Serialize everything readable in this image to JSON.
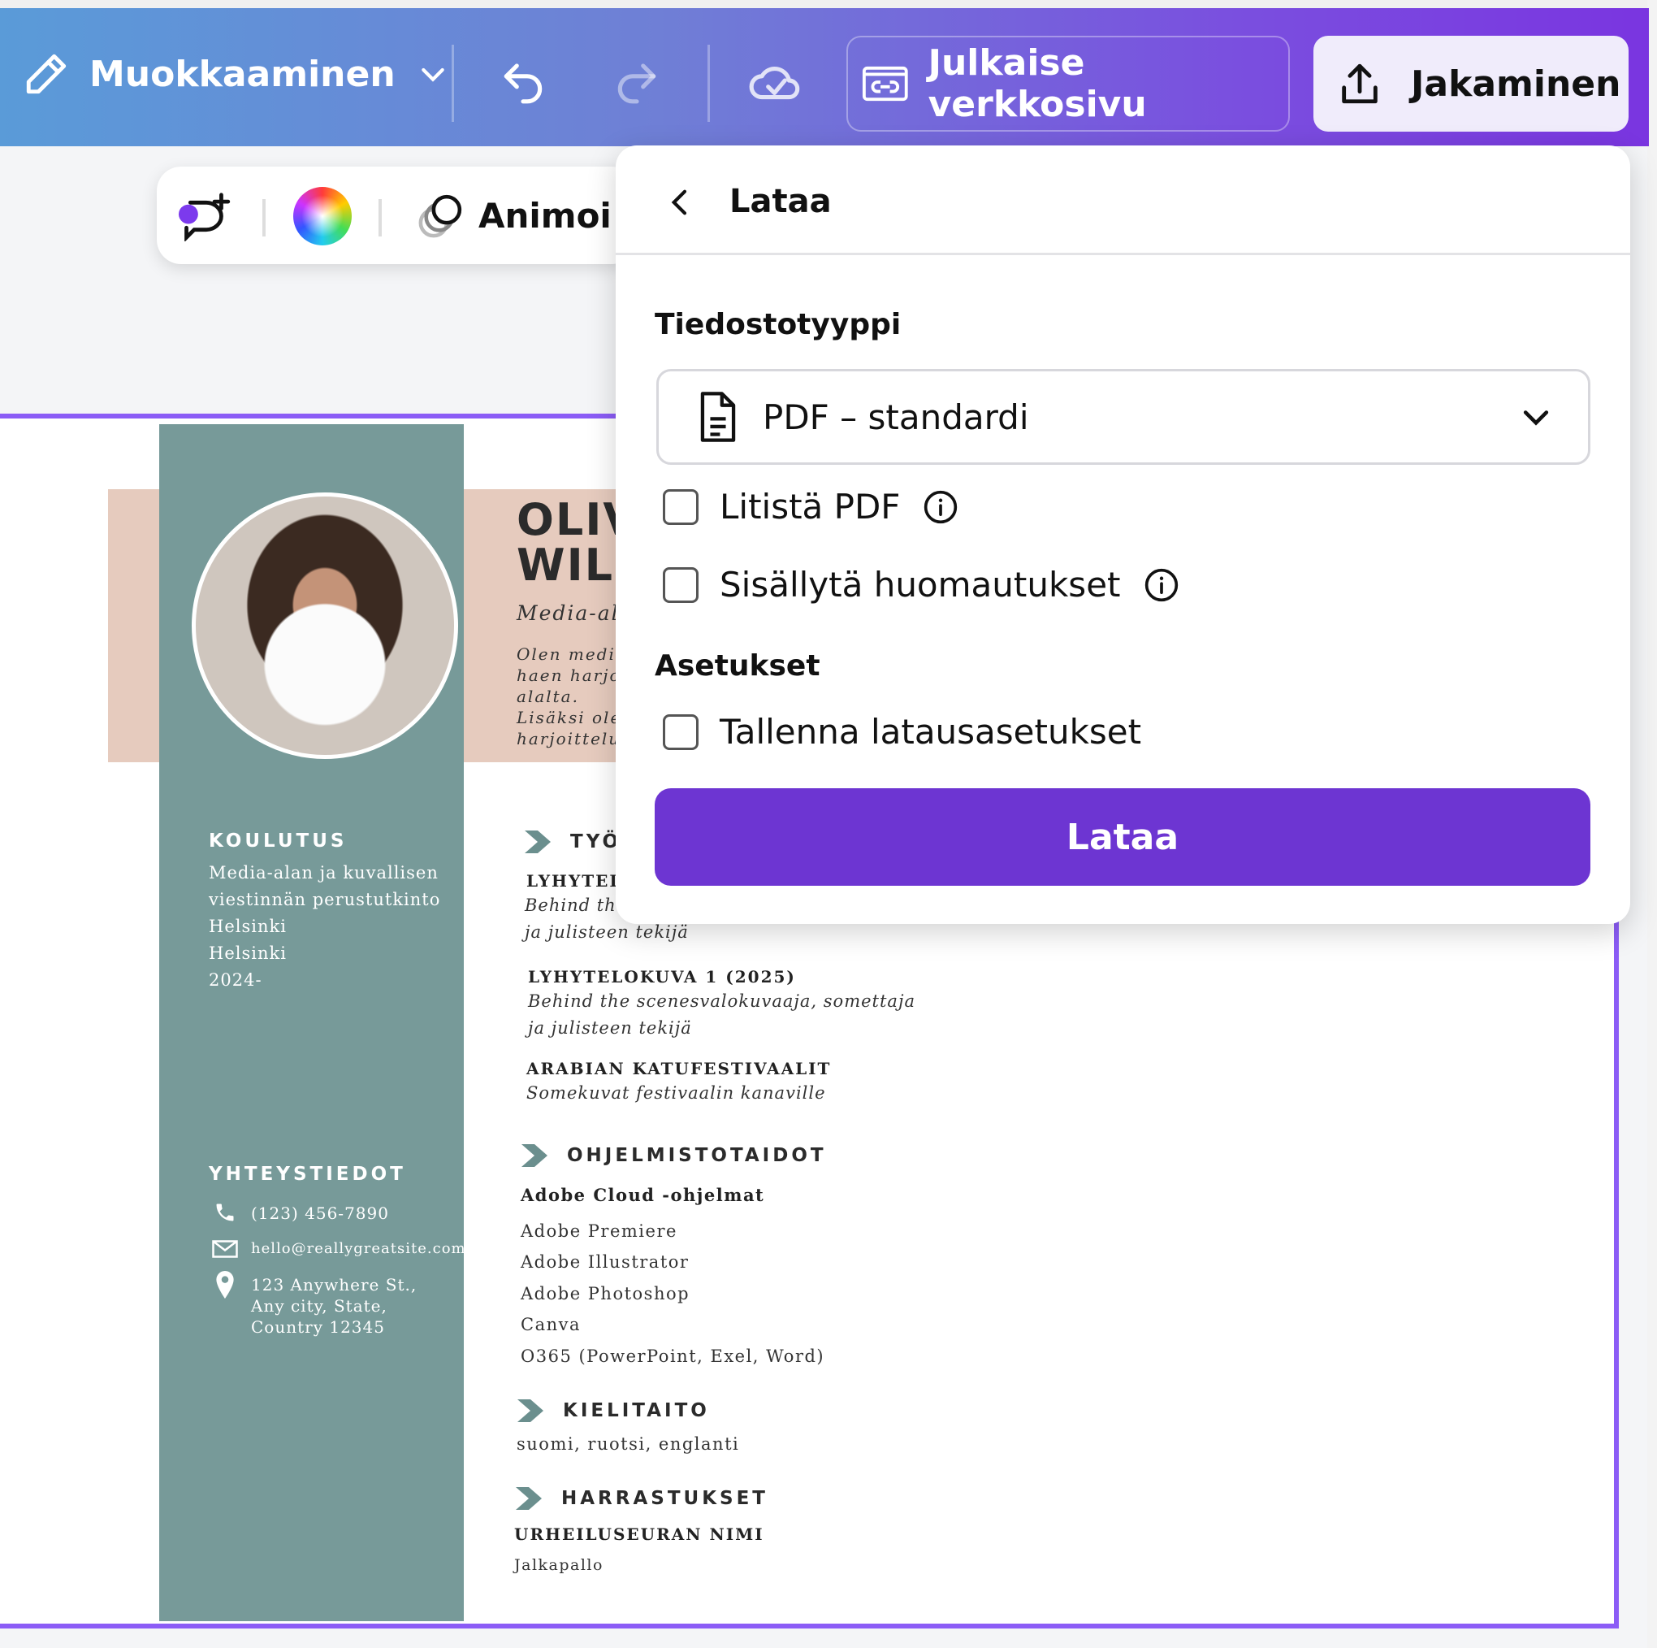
{
  "topbar": {
    "edit_label": "Muokkaaminen",
    "publish_label": "Julkaise verkkosivu",
    "share_label": "Jakaminen",
    "accent_color": "#7a35e0"
  },
  "float_toolbar": {
    "animate_label": "Animoi"
  },
  "download_panel": {
    "title": "Lataa",
    "file_type_label": "Tiedostotyyppi",
    "file_type_value": "PDF – standardi",
    "flatten_label": "Litistä PDF",
    "notes_label": "Sisällytä huomautukset",
    "settings_label": "Asetukset",
    "save_settings_label": "Tallenna latausasetukset",
    "download_button": "Lataa",
    "button_color": "#6d35d2"
  },
  "resume": {
    "name_line1": "OLIV",
    "name_line2": "WILS",
    "role": "Media-ala",
    "intro_lines": [
      "Olen media",
      "haen harjo",
      "alalta.",
      "Lisäksi olen",
      "harjoittelu"
    ],
    "education": {
      "heading": "KOULUTUS",
      "lines": [
        "Media-alan ja kuvallisen",
        "viestinnän perustutkinto",
        "Helsinki",
        "Helsinki",
        "2024-"
      ]
    },
    "contact": {
      "heading": "YHTEYSTIEDOT",
      "phone": "(123) 456-7890",
      "email": "hello@reallygreatsite.com",
      "address_lines": [
        "123 Anywhere St.,",
        "Any city, State,",
        "Country 12345"
      ]
    },
    "work": {
      "heading": "TYÖ",
      "job1_title": "LYHYTELO",
      "job1_desc": [
        "Behind the",
        "ja julisteen tekijä"
      ],
      "job2_title": "LYHYTELOKUVA 1 (2025)",
      "job2_desc": [
        "Behind the scenesvalokuvaaja, somettaja",
        "ja julisteen tekijä"
      ],
      "job3_title": "ARABIAN KATUFESTIVAALIT",
      "job3_desc": "Somekuvat festivaalin kanaville"
    },
    "software": {
      "heading": "OHJELMISTOTAIDOT",
      "subheading": "Adobe Cloud -ohjelmat",
      "items": [
        "Adobe Premiere",
        "Adobe Illustrator",
        "Adobe Photoshop",
        "Canva",
        "O365 (PowerPoint, Exel, Word)"
      ]
    },
    "languages": {
      "heading": "KIELITAITO",
      "text": "suomi, ruotsi, englanti"
    },
    "hobbies": {
      "heading": "HARRASTUKSET",
      "club": "URHEILUSEURAN NIMI",
      "sport": "Jalkapallo"
    },
    "side_color": "#779a99",
    "band_color": "#e6cbbe"
  }
}
